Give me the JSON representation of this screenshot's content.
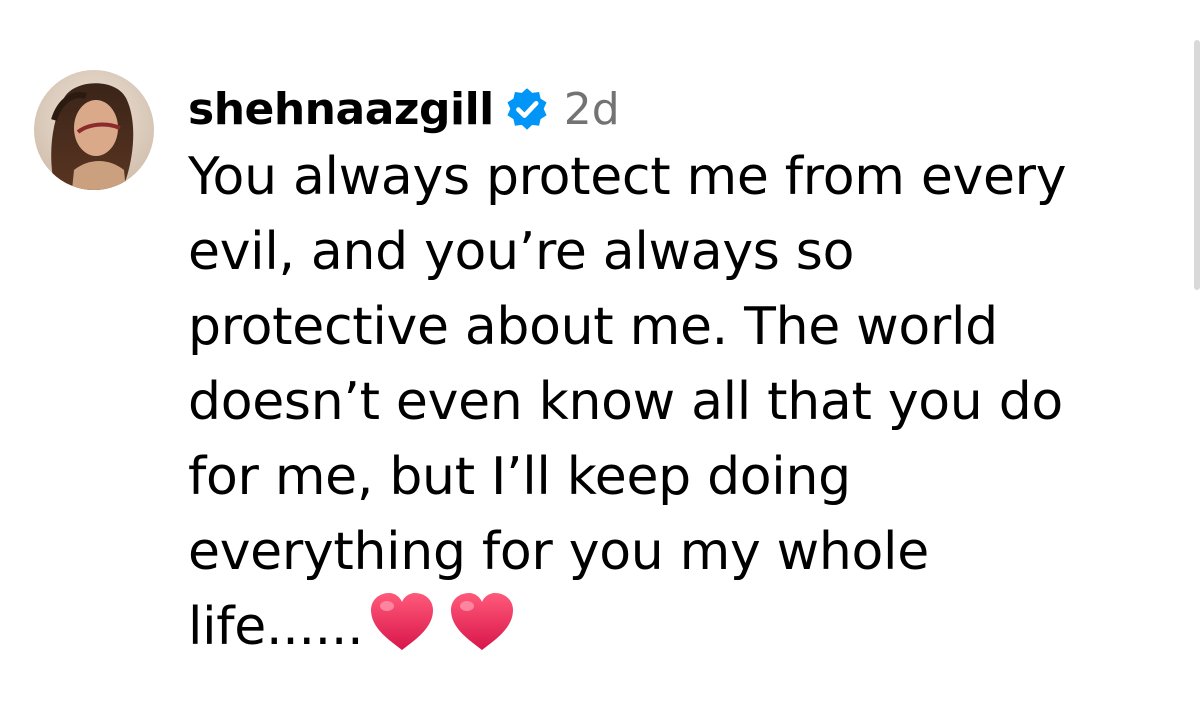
{
  "comment": {
    "username": "shehnaazgill",
    "verified": true,
    "time": "2d",
    "text_lines": [
      "You always protect me from every",
      "evil, and you’re always so",
      "protective about me. The world",
      "doesn’t even know all that you do",
      "for me, but I’ll keep doing",
      "everything for you my whole",
      "life......"
    ],
    "emojis": [
      "red-heart-emoji",
      "red-heart-emoji"
    ],
    "verified_color": "#0095F6",
    "heart_color": "#F01E5A"
  }
}
